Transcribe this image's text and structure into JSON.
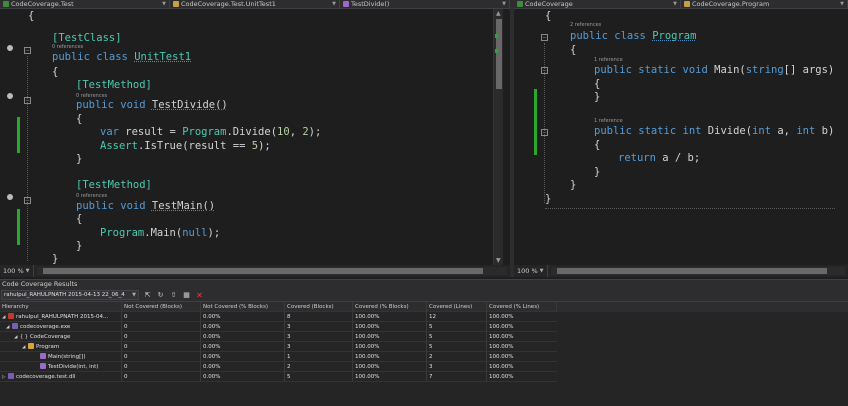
{
  "left_nav": {
    "project": "CodeCoverage.Test",
    "class": "CodeCoverage.Test.UnitTest1",
    "member": "TestDivide()"
  },
  "right_nav": {
    "project": "CodeCoverage",
    "class": "CodeCoverage.Program"
  },
  "left_editor": {
    "lens_class": "0 references",
    "lens_test_divide": "0 references",
    "lens_test_main": "0 references",
    "lines": {
      "l1": "{",
      "l2_attr": "[TestClass]",
      "l3_kw": "public class",
      "l3_name": "UnitTest1",
      "l4": "{",
      "l5_attr": "[TestMethod]",
      "l6_kw": "public void",
      "l6_name": "TestDivide()",
      "l7": "{",
      "l8_var": "var",
      "l8_mid": " result = ",
      "l8_type": "Program",
      "l8_call": ".Divide(",
      "l8_a": "10",
      "l8_comma": ", ",
      "l8_b": "2",
      "l8_end": ");",
      "l9_type": "Assert",
      "l9_rest": ".IsTrue(result == ",
      "l9_num": "5",
      "l9_end": ");",
      "l10": "}",
      "l11_attr": "[TestMethod]",
      "l12_kw": "public void",
      "l12_name": "TestMain()",
      "l13": "{",
      "l14_type": "Program",
      "l14_call": ".Main(",
      "l14_null": "null",
      "l14_end": ");",
      "l15": "}",
      "l16": "}",
      "l17": "}"
    }
  },
  "right_editor": {
    "lens_class": "2 references",
    "lens_main": "1 reference",
    "lens_divide": "1 reference",
    "lines": {
      "l1": "{",
      "l2_kw": "public class",
      "l2_name": "Program",
      "l3": "{",
      "l4_kw": "public static void",
      "l4_name": "Main(",
      "l4_type": "string",
      "l4_rest": "[] args)",
      "l5": "{",
      "l6": "}",
      "l7_kw": "public static int",
      "l7_name": "Divide(",
      "l7_int1": "int",
      "l7_a": " a, ",
      "l7_int2": "int",
      "l7_b": " b)",
      "l8": "{",
      "l9_kw": "return",
      "l9_rest": " a / b;",
      "l10": "}",
      "l11": "}",
      "l12": "}"
    }
  },
  "zoom_left": "100 %",
  "zoom_right": "100 %",
  "coverage_panel": {
    "title": "Code Coverage Results",
    "combo_value": "rahulpul_RAHULPNATH 2015-04-13 22_06_4",
    "columns": [
      "Hierarchy",
      "Not Covered (Blocks)",
      "Not Covered (% Blocks)",
      "Covered (Blocks)",
      "Covered (% Blocks)",
      "Covered (Lines)",
      "Covered (% Lines)"
    ],
    "rows": [
      {
        "name": "rahulpul_RAHULPNATH 2015-04...",
        "expander": "◢",
        "icon": "coverage-file-icon",
        "cells": [
          "0",
          "0.00%",
          "8",
          "100.00%",
          "12",
          "100.00%"
        ]
      },
      {
        "name": "codecoverage.exe",
        "expander": "◢",
        "icon": "assembly-icon",
        "cells": [
          "0",
          "0.00%",
          "3",
          "100.00%",
          "5",
          "100.00%"
        ]
      },
      {
        "name": "CodeCoverage",
        "expander": "◢",
        "icon": "namespace-icon",
        "icon_text": "{ }",
        "cells": [
          "0",
          "0.00%",
          "3",
          "100.00%",
          "5",
          "100.00%"
        ]
      },
      {
        "name": "Program",
        "expander": "◢",
        "icon": "class-icon",
        "cells": [
          "0",
          "0.00%",
          "3",
          "100.00%",
          "5",
          "100.00%"
        ]
      },
      {
        "name": "Main(string[])",
        "expander": "",
        "icon": "method-icon",
        "cells": [
          "0",
          "0.00%",
          "1",
          "100.00%",
          "2",
          "100.00%"
        ]
      },
      {
        "name": "TestDivide(int, int)",
        "expander": "",
        "icon": "method-icon",
        "cells": [
          "0",
          "0.00%",
          "2",
          "100.00%",
          "3",
          "100.00%"
        ]
      },
      {
        "name": "codecoverage.test.dll",
        "expander": "▷",
        "icon": "assembly-icon",
        "cells": [
          "0",
          "0.00%",
          "5",
          "100.00%",
          "7",
          "100.00%"
        ]
      }
    ]
  },
  "colors": {
    "keyword": "#569cd6",
    "type": "#4ec9b0",
    "number": "#b5cea8",
    "coverage_bar": "#29a829",
    "background": "#1e1e1e"
  }
}
